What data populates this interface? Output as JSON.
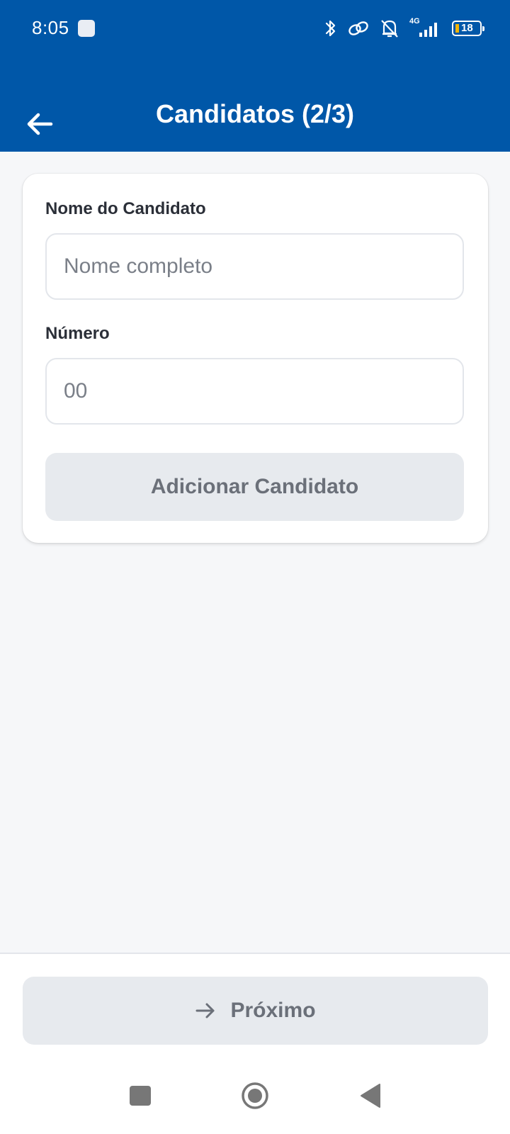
{
  "status_bar": {
    "time": "8:05",
    "network_label": "4G",
    "battery_level": "18"
  },
  "header": {
    "title": "Candidatos (2/3)"
  },
  "form": {
    "name_label": "Nome do Candidato",
    "name_placeholder": "Nome completo",
    "name_value": "",
    "number_label": "Número",
    "number_placeholder": "00",
    "number_value": "",
    "add_button_label": "Adicionar Candidato"
  },
  "footer": {
    "next_button_label": "Próximo"
  },
  "colors": {
    "header_bg": "#0057a8",
    "page_bg": "#f6f7f9",
    "disabled_button_bg": "#e7eaee",
    "disabled_button_text": "#6b7079"
  },
  "icons": {
    "back": "arrow-left-icon",
    "next": "arrow-right-icon"
  }
}
